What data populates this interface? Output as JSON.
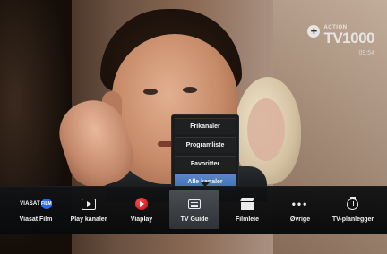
{
  "channel": {
    "logo_small": "ACTION",
    "logo_main": "TV1000",
    "time": "09:54"
  },
  "popup": {
    "items": [
      {
        "label": "Frikanaler",
        "active": false
      },
      {
        "label": "Programliste",
        "active": false
      },
      {
        "label": "Favoritter",
        "active": false
      },
      {
        "label": "Alle kanaler",
        "active": true
      }
    ]
  },
  "menu": {
    "viasat_logo_text": "VIASAT",
    "viasat_badge_text": "FILM",
    "items": [
      {
        "label": "Viasat Film",
        "icon": "viasat-film-logo"
      },
      {
        "label": "Play kanaler",
        "icon": "play-icon"
      },
      {
        "label": "Viaplay",
        "icon": "viaplay-icon"
      },
      {
        "label": "TV Guide",
        "icon": "guide-icon",
        "active": true
      },
      {
        "label": "Filmleie",
        "icon": "clapperboard-icon"
      },
      {
        "label": "Øvrige",
        "icon": "more-icon"
      },
      {
        "label": "TV-planlegger",
        "icon": "stopwatch-icon"
      }
    ]
  },
  "colors": {
    "active_popup": "#3c6fb6",
    "viaplay_red": "#c30d16",
    "film_badge": "#2a6be0"
  }
}
